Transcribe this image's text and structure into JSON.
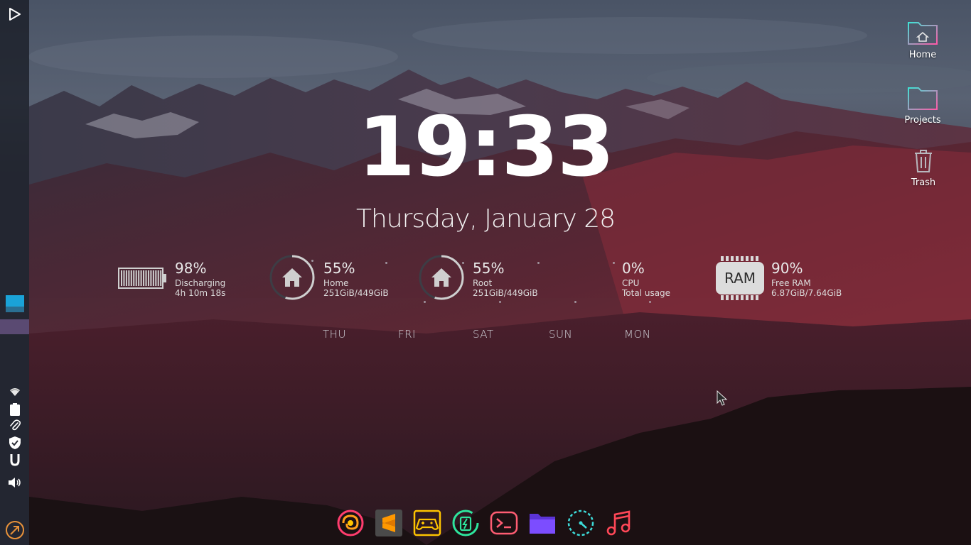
{
  "clock": {
    "time": "19:33",
    "date": "Thursday, January 28"
  },
  "battery": {
    "percent": "98%",
    "status": "Discharging",
    "remaining": "4h 10m 18s",
    "level": 0.98
  },
  "disk_home": {
    "percent": "55%",
    "name": "Home",
    "usage": "251GiB/449GiB",
    "level": 0.55
  },
  "disk_root": {
    "percent": "55%",
    "name": "Root",
    "usage": "251GiB/449GiB",
    "level": 0.55
  },
  "cpu": {
    "percent": "0%",
    "name": "CPU",
    "detail": "Total usage",
    "level": 0.0
  },
  "ram": {
    "chip_label": "RAM",
    "percent": "90%",
    "name": "Free RAM",
    "usage": "6.87GiB/7.64GiB",
    "level": 0.9
  },
  "weather_days": [
    "THU",
    "FRI",
    "SAT",
    "SUN",
    "MON"
  ],
  "desktop_icons": [
    {
      "label": "Home",
      "icon": "home-folder-icon"
    },
    {
      "label": "Projects",
      "icon": "folder-icon"
    },
    {
      "label": "Trash",
      "icon": "trash-icon"
    }
  ],
  "left_panel": {
    "launcher_icon": "play-launcher-icon",
    "workspace_colors": [
      "#1aa3d8",
      "#5a4a72"
    ],
    "tray": [
      "wifi-icon",
      "clipboard-icon",
      "paperclip-icon",
      "shield-icon",
      "magnet-icon",
      "volume-icon"
    ],
    "bottom_icon": "power-arrow-icon"
  },
  "dock": [
    {
      "name": "firefox-nightly",
      "icon": "browser-swirl-icon",
      "color": "#ff3d6e"
    },
    {
      "name": "sublime-text",
      "icon": "sublime-text-icon",
      "color": "#ff9800"
    },
    {
      "name": "game-tool",
      "icon": "gamepad-icon",
      "color": "#ffc400"
    },
    {
      "name": "power-stats",
      "icon": "battery-circle-icon",
      "color": "#2ee59d"
    },
    {
      "name": "terminal",
      "icon": "terminal-icon",
      "color": "#ff5d73"
    },
    {
      "name": "files",
      "icon": "folder-purple-icon",
      "color": "#7c4dff"
    },
    {
      "name": "system-monitor",
      "icon": "speedometer-icon",
      "color": "#3ddbd9"
    },
    {
      "name": "music",
      "icon": "music-note-icon",
      "color": "#ff4757"
    }
  ],
  "colors": {
    "accent_red": "#ff4757",
    "panel_bg": "#14161e"
  }
}
